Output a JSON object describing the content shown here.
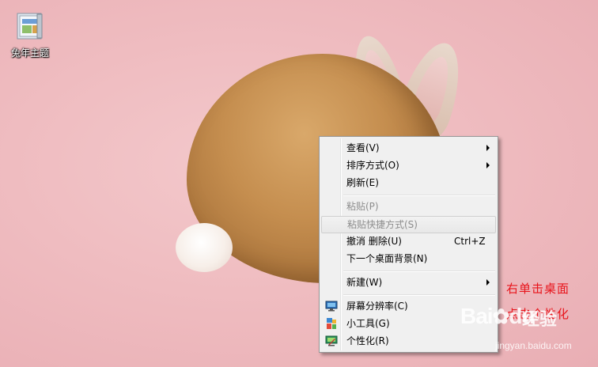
{
  "desktop": {
    "icon": {
      "label": "兔年主题",
      "icon": "folder-theme-icon"
    }
  },
  "context_menu": {
    "items": [
      {
        "label": "查看(V)",
        "submenu": true,
        "enabled": true
      },
      {
        "label": "排序方式(O)",
        "submenu": true,
        "enabled": true
      },
      {
        "label": "刷新(E)",
        "enabled": true
      },
      {
        "label": "粘贴(P)",
        "enabled": false
      },
      {
        "label": "粘贴快捷方式(S)",
        "enabled": false,
        "highlighted": true
      },
      {
        "label": "撤消 删除(U)",
        "shortcut": "Ctrl+Z",
        "enabled": true
      },
      {
        "label": "下一个桌面背景(N)",
        "enabled": true
      },
      {
        "label": "新建(W)",
        "submenu": true,
        "enabled": true
      },
      {
        "label": "屏幕分辨率(C)",
        "icon": "monitor-icon",
        "enabled": true
      },
      {
        "label": "小工具(G)",
        "icon": "gadgets-icon",
        "enabled": true
      },
      {
        "label": "个性化(R)",
        "icon": "personalize-icon",
        "enabled": true
      }
    ]
  },
  "annotation": {
    "line1": "右单击桌面",
    "line2": "点击个性化",
    "color": "#e8141b"
  },
  "watermark": {
    "brand": "Bai",
    "brand2": "du",
    "brand_cn": "经验",
    "url": "jingyan.baidu.com"
  }
}
